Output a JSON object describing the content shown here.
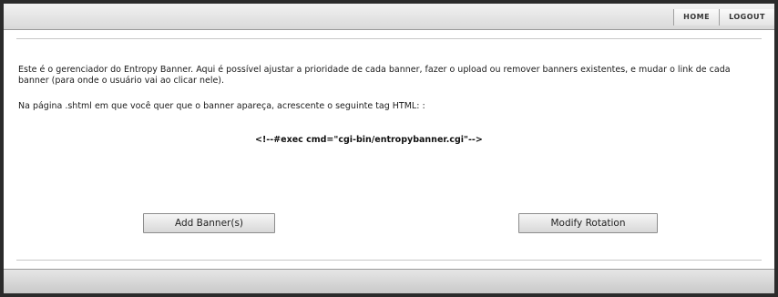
{
  "nav": {
    "home": "HOME",
    "logout": "LOGOUT"
  },
  "intro": "Este é o gerenciador do Entropy Banner. Aqui é possível ajustar a prioridade de cada banner, fazer o upload ou remover banners existentes, e mudar o link de cada banner (para onde o usuário vai ao clicar nele).",
  "instruction": "Na página .shtml em que você quer que o banner apareça, acrescente o seguinte tag HTML: :",
  "code_snippet": "<!--#exec cmd=\"cgi-bin/entropybanner.cgi\"-->",
  "buttons": {
    "add": "Add Banner(s)",
    "modify": "Modify Rotation"
  }
}
